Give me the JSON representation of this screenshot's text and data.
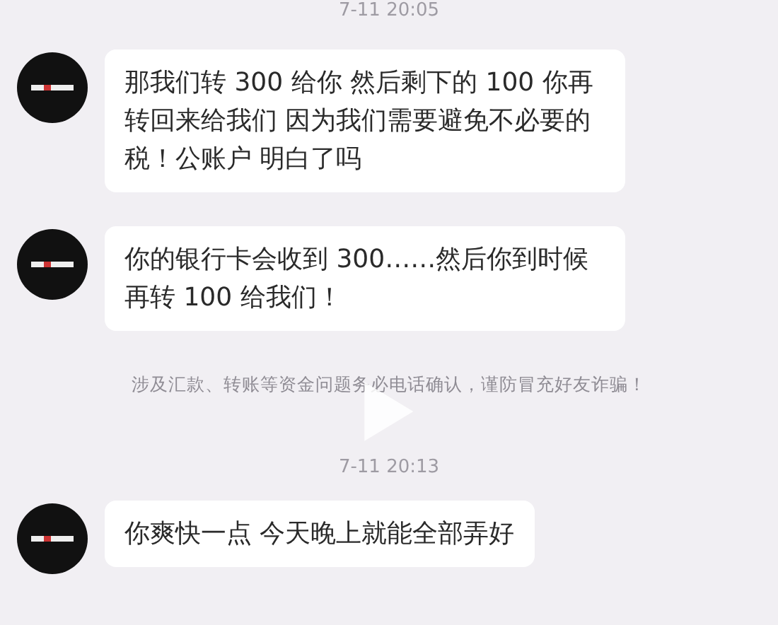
{
  "items": [
    {
      "kind": "time",
      "text": "7-11 20:05"
    },
    {
      "kind": "message",
      "text": "那我们转 300 给你  然后剩下的 100 你再转回来给我们  因为我们需要避免不必要的税！公账户  明白了吗"
    },
    {
      "kind": "message",
      "text": "你的银行卡会收到 300……然后你到时候再转 100 给我们！"
    },
    {
      "kind": "notice",
      "text": "涉及汇款、转账等资金问题务必电话确认，谨防冒充好友诈骗！"
    },
    {
      "kind": "time",
      "text": "7-11 20:13"
    },
    {
      "kind": "message",
      "text": "你爽快一点  今天晚上就能全部弄好"
    }
  ]
}
